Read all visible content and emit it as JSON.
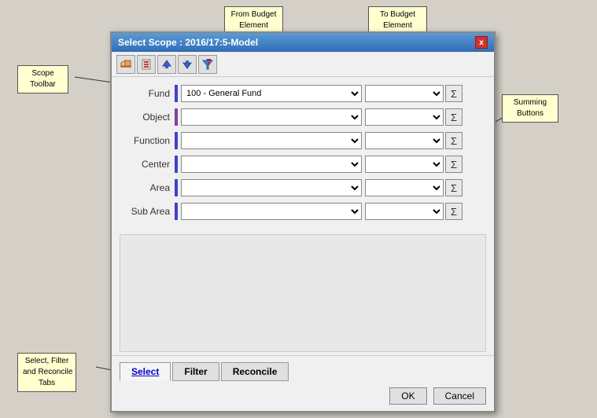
{
  "dialog": {
    "title": "Select Scope : 2016/17:5-Model",
    "close_label": "x"
  },
  "toolbar": {
    "buttons": [
      "eraser",
      "delete",
      "up",
      "down",
      "filter"
    ]
  },
  "form": {
    "rows": [
      {
        "label": "Fund",
        "from_value": "100 - General Fund",
        "to_value": "",
        "bar_color": "blue"
      },
      {
        "label": "Object",
        "from_value": "",
        "to_value": "",
        "bar_color": "purple"
      },
      {
        "label": "Function",
        "from_value": "",
        "to_value": "",
        "bar_color": "blue"
      },
      {
        "label": "Center",
        "from_value": "",
        "to_value": "",
        "bar_color": "blue"
      },
      {
        "label": "Area",
        "from_value": "",
        "to_value": "",
        "bar_color": "blue"
      },
      {
        "label": "Sub Area",
        "from_value": "",
        "to_value": "",
        "bar_color": "blue"
      }
    ]
  },
  "tabs": [
    {
      "label": "Select",
      "active": true
    },
    {
      "label": "Filter",
      "active": false
    },
    {
      "label": "Reconcile",
      "active": false
    }
  ],
  "buttons": {
    "ok_label": "OK",
    "cancel_label": "Cancel"
  },
  "callouts": {
    "scope_toolbar": "Scope\nToolbar",
    "from_budget": "From Budget\nElement",
    "to_budget": "To Budget\nElement",
    "summing": "Summing\nButtons",
    "tabs": "Select, Filter\nand Reconcile\nTabs"
  },
  "sigma_symbol": "Σ"
}
